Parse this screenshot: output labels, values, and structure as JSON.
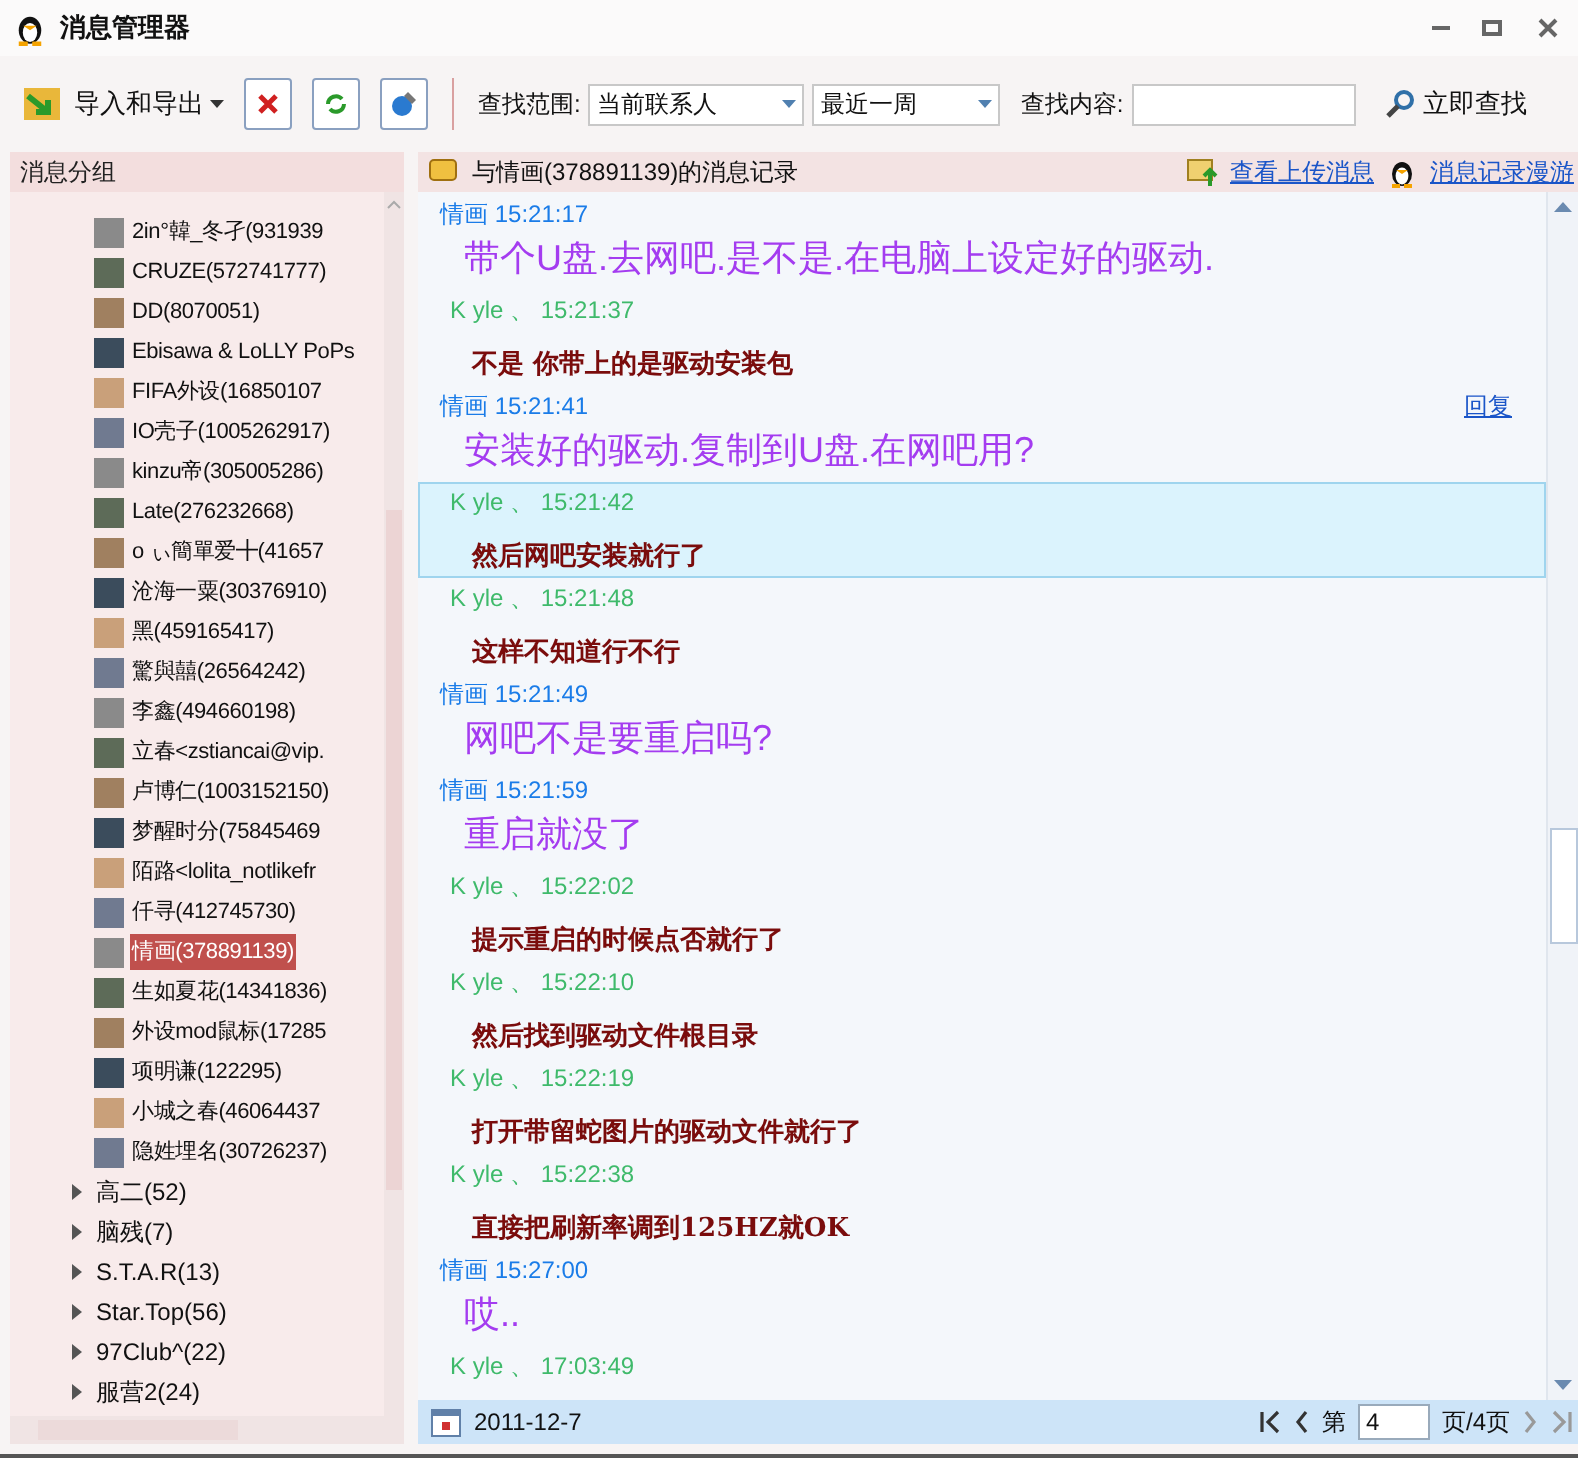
{
  "window": {
    "title": "消息管理器"
  },
  "toolbar": {
    "import_export": "导入和导出",
    "scope_label": "查找范围:",
    "scope": "当前联系人",
    "period": "最近一周",
    "content_label": "查找内容:",
    "search_button": "立即查找"
  },
  "sidebar": {
    "title": "消息分组",
    "contacts": [
      {
        "label": "2in°韓_冬孑(931939",
        "selected": false
      },
      {
        "label": "CRUZE(572741777)",
        "selected": false
      },
      {
        "label": "DD(8070051)",
        "selected": false
      },
      {
        "label": "Ebisawa & LoLLY PoPs",
        "selected": false
      },
      {
        "label": "FIFA外设(16850107",
        "selected": false
      },
      {
        "label": "IO壳子(1005262917)",
        "selected": false
      },
      {
        "label": "kinzu帝(305005286)",
        "selected": false
      },
      {
        "label": "Late(276232668)",
        "selected": false
      },
      {
        "label": "o ぃ簡單爱╋(41657",
        "selected": false
      },
      {
        "label": "沧海一粟(30376910)",
        "selected": false
      },
      {
        "label": "黑(459165417)",
        "selected": false
      },
      {
        "label": "驚與囍(26564242)",
        "selected": false
      },
      {
        "label": "李鑫(494660198)",
        "selected": false
      },
      {
        "label": "立春<zstiancai@vip.",
        "selected": false
      },
      {
        "label": "卢博仁(1003152150)",
        "selected": false
      },
      {
        "label": "梦醒时分(75845469",
        "selected": false
      },
      {
        "label": "陌路<lolita_notlikefr",
        "selected": false
      },
      {
        "label": "仟寻(412745730)",
        "selected": false
      },
      {
        "label": "情画(378891139)",
        "selected": true
      },
      {
        "label": "生如夏花(14341836)",
        "selected": false
      },
      {
        "label": "外设mod鼠标(17285",
        "selected": false
      },
      {
        "label": "项明谦(122295)",
        "selected": false
      },
      {
        "label": "小城之春(46064437",
        "selected": false
      },
      {
        "label": "隐姓埋名(30726237)",
        "selected": false
      }
    ],
    "groups": [
      {
        "label": "高二(52)",
        "expanded": false
      },
      {
        "label": "脑残(7)",
        "expanded": false
      },
      {
        "label": "S.T.A.R(13)",
        "expanded": false
      },
      {
        "label": "Star.Top(56)",
        "expanded": false
      },
      {
        "label": "97Club^(22)",
        "expanded": false
      },
      {
        "label": "服营2(24)",
        "expanded": false
      }
    ]
  },
  "chat": {
    "title": "与情画(378891139)的消息记录",
    "upload_link": "查看上传消息",
    "roam_link": "消息记录漫游",
    "messages": [
      {
        "kind": "them",
        "sender": "情画",
        "time": "15:21:17",
        "text": "带个U盘.去网吧.是不是.在电脑上设定好的驱动.",
        "selected": false
      },
      {
        "kind": "me",
        "sender": "K yle 、",
        "time": "15:21:37",
        "text": "不是 你带上的是驱动安装包",
        "selected": false
      },
      {
        "kind": "them",
        "sender": "情画",
        "time": "15:21:41",
        "text": "安装好的驱动.复制到U盘.在网吧用?",
        "selected": false,
        "action": "回复"
      },
      {
        "kind": "me",
        "sender": "K yle 、",
        "time": "15:21:42",
        "text": "然后网吧安装就行了",
        "selected": true
      },
      {
        "kind": "me",
        "sender": "K yle 、",
        "time": "15:21:48",
        "text": "这样不知道行不行",
        "selected": false
      },
      {
        "kind": "them",
        "sender": "情画",
        "time": "15:21:49",
        "text": "网吧不是要重启吗?",
        "selected": false
      },
      {
        "kind": "them",
        "sender": "情画",
        "time": "15:21:59",
        "text": "重启就没了",
        "selected": false
      },
      {
        "kind": "me",
        "sender": "K yle 、",
        "time": "15:22:02",
        "text": "提示重启的时候点否就行了",
        "selected": false
      },
      {
        "kind": "me",
        "sender": "K yle 、",
        "time": "15:22:10",
        "text": "然后找到驱动文件根目录",
        "selected": false
      },
      {
        "kind": "me",
        "sender": "K yle 、",
        "time": "15:22:19",
        "text": "打开带留蛇图片的驱动文件就行了",
        "selected": false
      },
      {
        "kind": "me",
        "sender": "K yle 、",
        "time": "15:22:38",
        "text": "直接把刷新率调到125HZ就OK",
        "selected": false
      },
      {
        "kind": "them",
        "sender": "情画",
        "time": "15:27:00",
        "text": "哎..",
        "selected": false
      },
      {
        "kind": "me",
        "sender": "K yle 、",
        "time": "17:03:49",
        "selected": false
      }
    ]
  },
  "footer": {
    "date": "2011-12-7",
    "page_prefix": "第",
    "page": "4",
    "page_suffix": "页/4页"
  }
}
